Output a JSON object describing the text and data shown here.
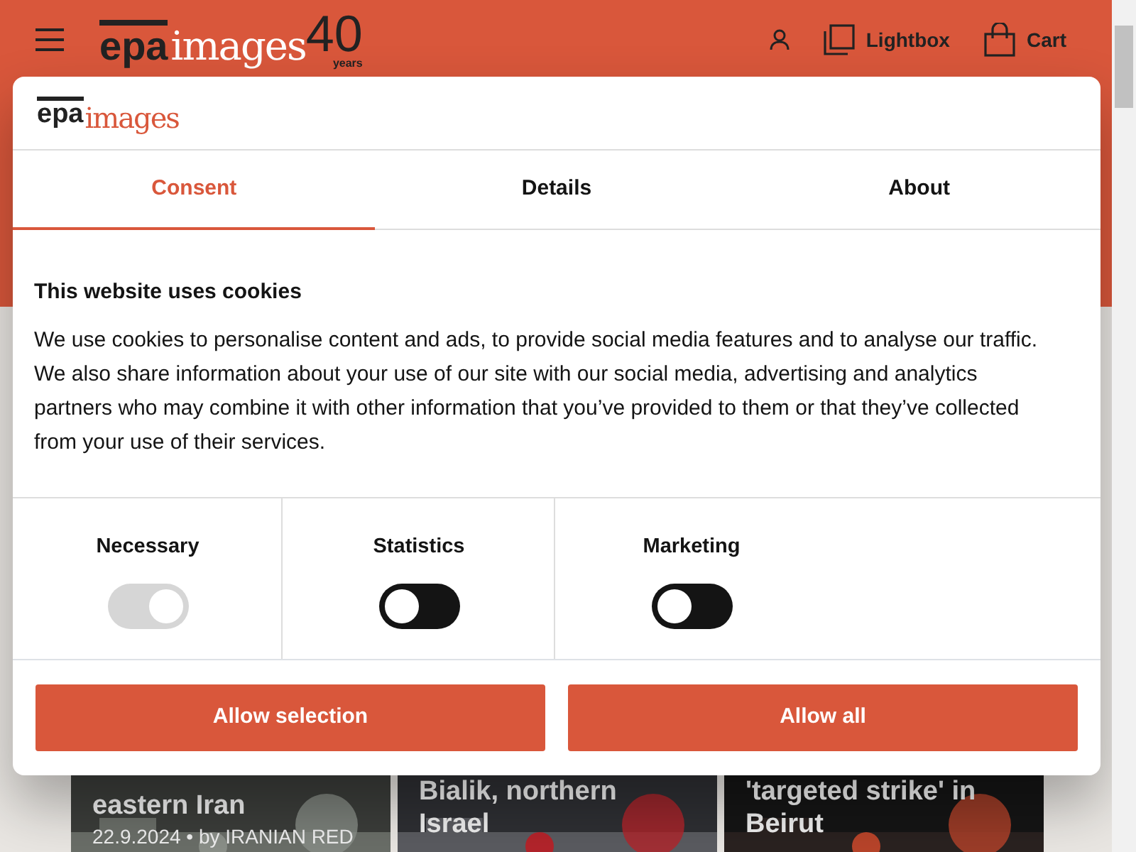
{
  "header": {
    "logo": {
      "brand": "epa",
      "product": "images",
      "anniversary": "40",
      "anniversary_caption": "years"
    },
    "actions": [
      {
        "kind": "account"
      },
      {
        "kind": "lightbox",
        "label": "Lightbox"
      },
      {
        "kind": "cart",
        "label": "Cart"
      }
    ]
  },
  "news_cards": [
    {
      "title_lines": [
        "eastern Iran"
      ],
      "meta": "22.9.2024  •  by IRANIAN RED",
      "kind": "picture"
    },
    {
      "title_lines": [
        "Bialik, northern",
        "Israel"
      ],
      "kind": "picture"
    },
    {
      "title_lines": [
        "'targeted strike' in",
        "Beirut"
      ],
      "kind": "picture"
    }
  ],
  "cookie_dialog": {
    "logo": {
      "brand": "epa",
      "product": "images"
    },
    "tabs": [
      {
        "label": "Consent",
        "selected": true
      },
      {
        "label": "Details",
        "selected": false
      },
      {
        "label": "About",
        "selected": false
      }
    ],
    "heading": "This website uses cookies",
    "text": "We use cookies to personalise content and ads, to provide social media features and to analyse our traffic. We also share information about your use of our site with our social media, advertising and analytics partners who may combine it with other information that you’ve provided to them or that they’ve collected from your use of their services.",
    "toggles": [
      {
        "label": "Necessary",
        "on": true,
        "disabled": true
      },
      {
        "label": "Statistics",
        "on": false,
        "disabled": false
      },
      {
        "label": "Marketing",
        "on": false,
        "disabled": false
      }
    ],
    "buttons": [
      "Allow selection",
      "Allow all"
    ]
  }
}
